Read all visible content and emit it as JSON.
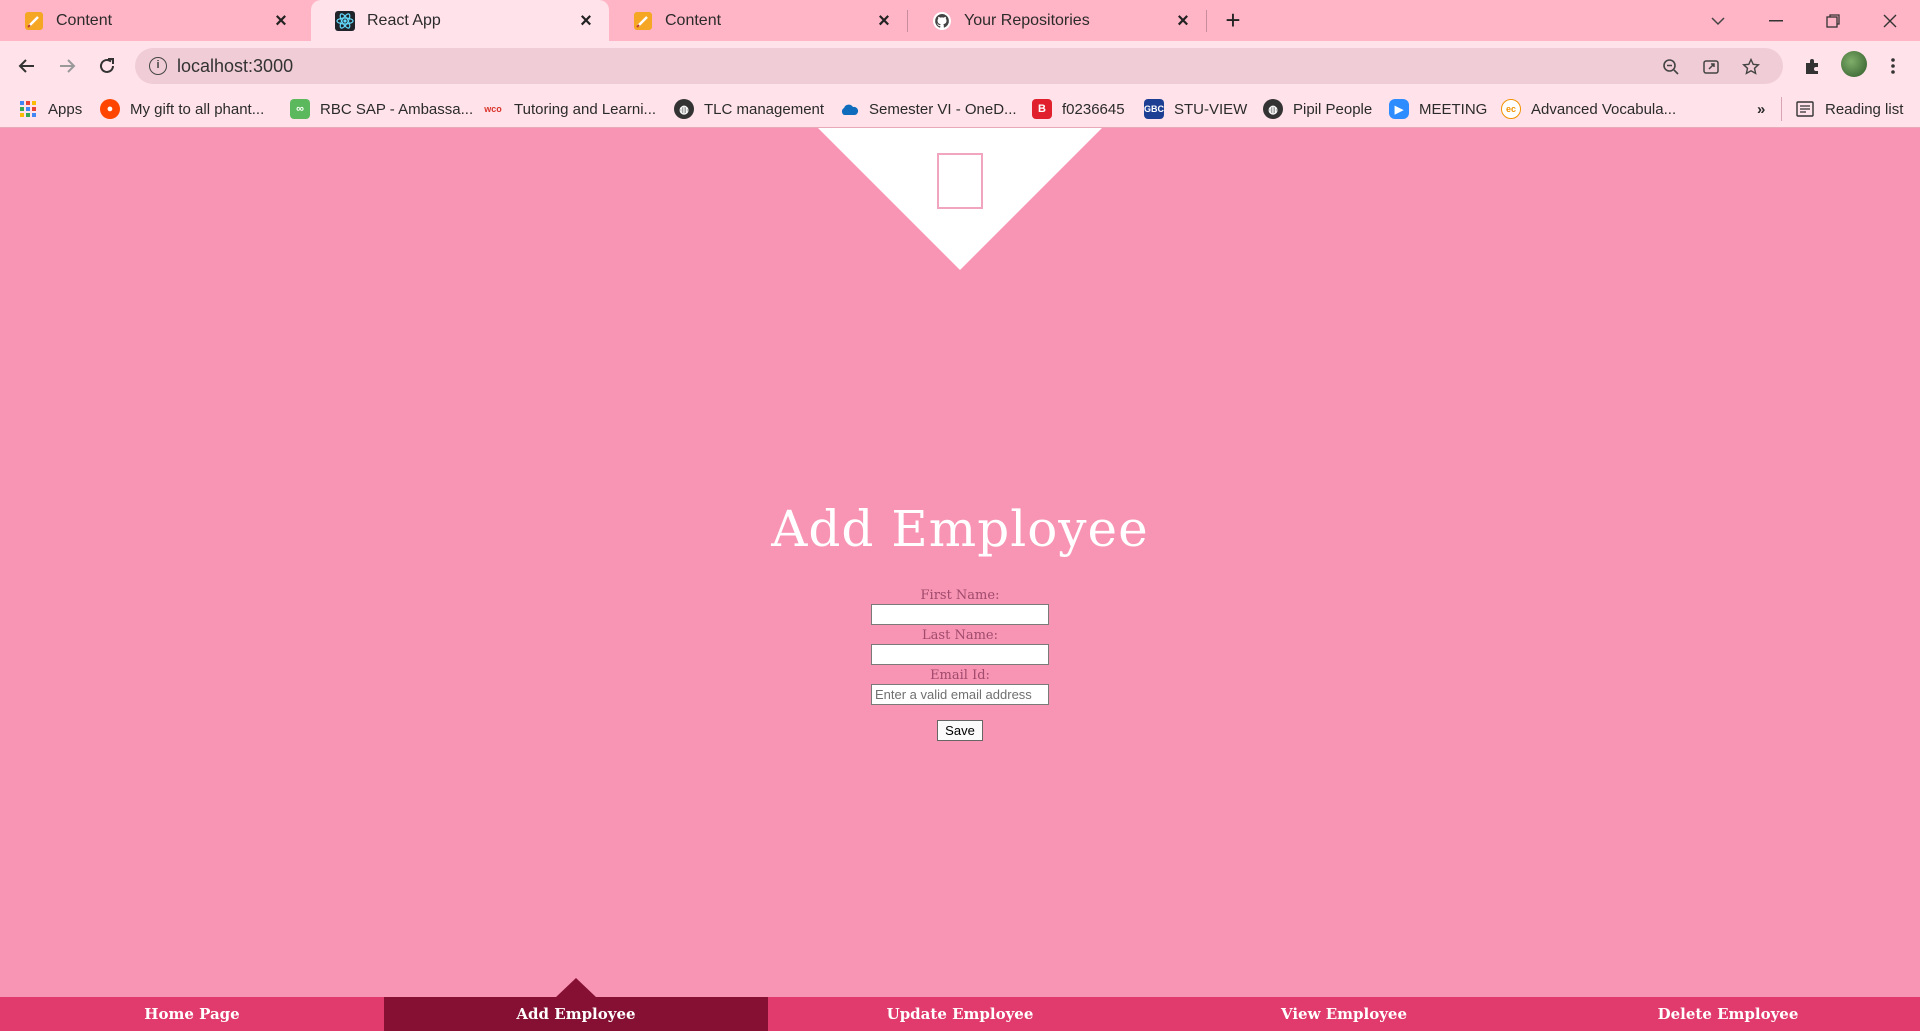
{
  "browser": {
    "tabs": [
      {
        "title": "Content",
        "icon": "pencil-icon",
        "active": false
      },
      {
        "title": "React App",
        "icon": "react-icon",
        "active": true
      },
      {
        "title": "Content",
        "icon": "pencil-icon",
        "active": false
      },
      {
        "title": "Your Repositories",
        "icon": "github-icon",
        "active": false
      }
    ],
    "url": "localhost:3000",
    "bookmarks": [
      {
        "label": "Apps",
        "icon": "apps-grid-icon"
      },
      {
        "label": "My gift to all phant...",
        "icon": "reddit-icon"
      },
      {
        "label": "RBC SAP - Ambassa...",
        "icon": "link-icon"
      },
      {
        "label": "Tutoring and Learni...",
        "icon": "wco-icon"
      },
      {
        "label": "TLC management",
        "icon": "globe-icon"
      },
      {
        "label": "Semester VI - OneD...",
        "icon": "onedrive-icon"
      },
      {
        "label": "f0236645",
        "icon": "b-icon"
      },
      {
        "label": "STU-VIEW",
        "icon": "stu-view-icon"
      },
      {
        "label": "Pipil People",
        "icon": "globe-icon"
      },
      {
        "label": "MEETING",
        "icon": "zoom-icon"
      },
      {
        "label": "Advanced Vocabula...",
        "icon": "ec-icon"
      }
    ],
    "reading_list": "Reading list",
    "more_bookmarks": "»",
    "new_tab_glyph": "+",
    "colors": {
      "tabstrip": "#ffb5c6",
      "toolbar": "#ffe2ea",
      "omnibox": "#f0ccd6"
    }
  },
  "page": {
    "heading": "Add Employee",
    "form": {
      "first_name_label": "First Name:",
      "first_name_value": "",
      "last_name_label": "Last Name:",
      "last_name_value": "",
      "email_label": "Email Id:",
      "email_value": "",
      "email_placeholder": "Enter a valid email address",
      "save_label": "Save"
    },
    "nav": [
      {
        "label": "Home Page",
        "active": false
      },
      {
        "label": "Add Employee",
        "active": true
      },
      {
        "label": "Update Employee",
        "active": false
      },
      {
        "label": "View Employee",
        "active": false
      },
      {
        "label": "Delete Employee",
        "active": false
      }
    ],
    "colors": {
      "background": "#f895b4",
      "nav": "#e13a6c",
      "nav_active": "#851033",
      "heading": "#ffffff"
    }
  }
}
